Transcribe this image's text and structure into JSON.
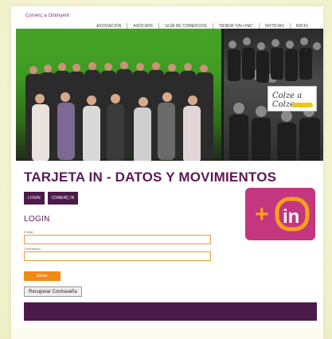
{
  "header": {
    "brand": "Comerç a Ontinyent",
    "nav": [
      {
        "label": "ASOCIACIÓN"
      },
      {
        "label": "ASÓCIATE"
      },
      {
        "label": "GUÍA DE COMERCIOS"
      },
      {
        "label": "TIENDA \"ON-LINE\""
      },
      {
        "label": "NOTICIAS"
      },
      {
        "label": "INICIO"
      }
    ]
  },
  "hero": {
    "logo_text": "Colze a Colze"
  },
  "main": {
    "title": "TARJETA IN - DATOS Y MOVIMIENTOS",
    "tabs": [
      {
        "label": "LOGIN"
      },
      {
        "label": "COMERÇ IN"
      }
    ],
    "badge": {
      "plus": "+",
      "text": "in"
    },
    "section_title": "LOGIN",
    "form": {
      "email_label": "E-Mail",
      "email_value": "",
      "password_label": "Contraseña",
      "password_value": "",
      "submit_label": "Entrar",
      "recover_label": "Recuperar Contraseña"
    }
  },
  "colors": {
    "brand_purple": "#4b1a4a",
    "accent_orange": "#f08a15",
    "badge_pink": "#c4367f",
    "title_purple": "#5b1a52"
  }
}
